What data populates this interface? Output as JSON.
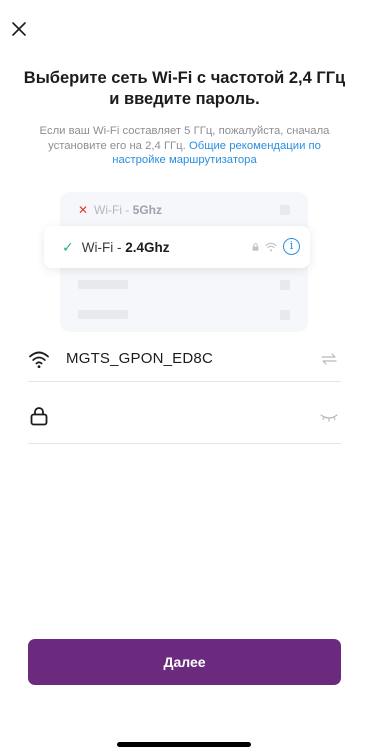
{
  "header": {
    "close_icon": "close-icon"
  },
  "title": "Выберите сеть Wi-Fi с частотой 2,4 ГГц и введите пароль.",
  "subtitle": {
    "text": "Если ваш Wi-Fi составляет 5 ГГц, пожалуйста, сначала установите его на 2,4 ГГц. ",
    "link": "Общие рекомендации по настройке маршрутизатора"
  },
  "illustration": {
    "row_5g": {
      "prefix": "Wi-Fi - ",
      "band": "5Ghz",
      "mark": "✕"
    },
    "row_24g": {
      "prefix": "Wi-Fi - ",
      "band": "2.4Ghz",
      "mark": "✓"
    },
    "info_glyph": "i"
  },
  "form": {
    "ssid": {
      "icon": "wifi-icon",
      "value": "MGTS_GPON_ED8C",
      "trail_icon": "switch-arrows-icon"
    },
    "password": {
      "icon": "lock-icon",
      "value": "",
      "placeholder": "",
      "trail_icon": "eye-closed-icon"
    }
  },
  "actions": {
    "next_label": "Далее"
  },
  "colors": {
    "primary": "#6b2a7e",
    "link": "#2b8fe0",
    "success": "#22b573",
    "error": "#e53935"
  }
}
